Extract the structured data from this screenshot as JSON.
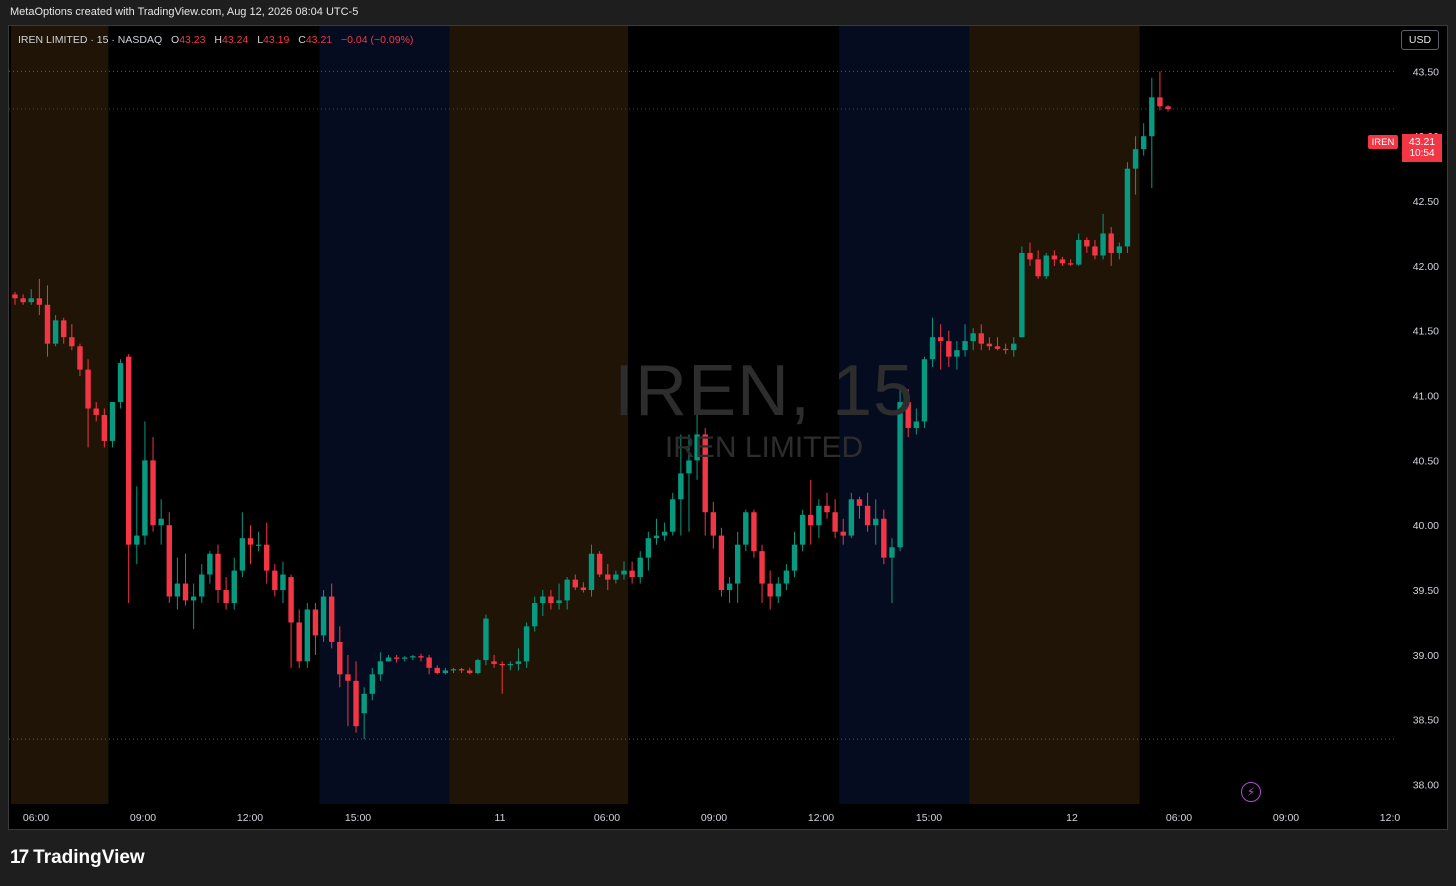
{
  "caption": "MetaOptions created with TradingView.com, Aug 12, 2026 08:04 UTC-5",
  "legend": {
    "symbol": "IREN LIMITED · 15 · NASDAQ",
    "open_key": "O",
    "open": "43.23",
    "high_key": "H",
    "high": "43.24",
    "low_key": "L",
    "low": "43.19",
    "close_key": "C",
    "close": "43.21",
    "change": "−0.04 (−0.09%)"
  },
  "currency_button": "USD",
  "watermark": {
    "main": "IREN, 15",
    "sub": "IREN LIMITED"
  },
  "last_price": {
    "symbol": "IREN",
    "price": "43.21",
    "countdown": "10:54"
  },
  "footer_logo": {
    "mark": "17",
    "text": "TradingView"
  },
  "icons": {
    "alert": "lightning-icon"
  },
  "colors": {
    "up": "#089981",
    "down": "#f23645",
    "premarket": "#1f1406",
    "postmarket": "#050c1f",
    "background": "#000000"
  },
  "chart_data": {
    "type": "candlestick",
    "ylim": [
      37.85,
      43.85
    ],
    "yticks": [
      "43.50",
      "43.00",
      "42.50",
      "42.00",
      "41.50",
      "41.00",
      "40.50",
      "40.00",
      "39.50",
      "39.00",
      "38.50",
      "38.00"
    ],
    "xticks": [
      "06:00",
      "09:00",
      "12:00",
      "15:00",
      "11",
      "06:00",
      "09:00",
      "12:00",
      "15:00",
      "12",
      "06:00",
      "09:00",
      "12:0"
    ],
    "dotted_levels": [
      43.5,
      43.21,
      38.35
    ],
    "session_bands": [
      {
        "type": "premarket",
        "from": 0,
        "to": 12
      },
      {
        "type": "postmarket",
        "from": 38,
        "to": 54
      },
      {
        "type": "premarket",
        "from": 54,
        "to": 76
      },
      {
        "type": "postmarket",
        "from": 102,
        "to": 118
      },
      {
        "type": "premarket",
        "from": 118,
        "to": 139
      }
    ],
    "candles": [
      [
        41.78,
        41.8,
        41.7,
        41.75
      ],
      [
        41.75,
        41.78,
        41.7,
        41.72
      ],
      [
        41.72,
        41.82,
        41.7,
        41.75
      ],
      [
        41.75,
        41.9,
        41.62,
        41.7
      ],
      [
        41.7,
        41.85,
        41.3,
        41.4
      ],
      [
        41.4,
        41.62,
        41.38,
        41.58
      ],
      [
        41.58,
        41.6,
        41.4,
        41.45
      ],
      [
        41.45,
        41.55,
        41.35,
        41.38
      ],
      [
        41.38,
        41.4,
        41.15,
        41.2
      ],
      [
        41.2,
        41.28,
        40.6,
        40.9
      ],
      [
        40.9,
        40.95,
        40.8,
        40.85
      ],
      [
        40.85,
        40.9,
        40.6,
        40.65
      ],
      [
        40.65,
        40.95,
        40.6,
        40.95
      ],
      [
        40.95,
        41.28,
        40.9,
        41.25
      ],
      [
        41.3,
        41.32,
        39.4,
        39.85
      ],
      [
        39.85,
        40.3,
        39.7,
        39.92
      ],
      [
        39.92,
        40.8,
        39.85,
        40.5
      ],
      [
        40.5,
        40.68,
        39.95,
        40.0
      ],
      [
        40.0,
        40.2,
        39.85,
        40.05
      ],
      [
        40.0,
        40.1,
        39.4,
        39.45
      ],
      [
        39.45,
        39.75,
        39.35,
        39.55
      ],
      [
        39.55,
        39.78,
        39.38,
        39.42
      ],
      [
        39.42,
        39.55,
        39.2,
        39.45
      ],
      [
        39.45,
        39.7,
        39.4,
        39.62
      ],
      [
        39.62,
        39.8,
        39.55,
        39.78
      ],
      [
        39.78,
        39.85,
        39.4,
        39.5
      ],
      [
        39.5,
        39.6,
        39.35,
        39.4
      ],
      [
        39.4,
        39.75,
        39.35,
        39.65
      ],
      [
        39.65,
        40.1,
        39.6,
        39.9
      ],
      [
        39.9,
        40.0,
        39.7,
        39.85
      ],
      [
        39.85,
        39.95,
        39.8,
        39.85
      ],
      [
        39.85,
        40.02,
        39.55,
        39.65
      ],
      [
        39.65,
        39.7,
        39.45,
        39.5
      ],
      [
        39.5,
        39.72,
        39.4,
        39.62
      ],
      [
        39.6,
        39.62,
        38.9,
        39.25
      ],
      [
        39.25,
        39.35,
        38.9,
        38.95
      ],
      [
        38.95,
        39.4,
        38.9,
        39.35
      ],
      [
        39.35,
        39.4,
        39.0,
        39.15
      ],
      [
        39.15,
        39.5,
        39.1,
        39.45
      ],
      [
        39.45,
        39.55,
        39.05,
        39.1
      ],
      [
        39.1,
        39.22,
        38.75,
        38.85
      ],
      [
        38.85,
        39.0,
        38.45,
        38.8
      ],
      [
        38.8,
        38.95,
        38.4,
        38.45
      ],
      [
        38.55,
        38.75,
        38.35,
        38.7
      ],
      [
        38.7,
        38.9,
        38.65,
        38.85
      ],
      [
        38.85,
        39.02,
        38.8,
        38.95
      ],
      [
        38.95,
        39.0,
        38.95,
        38.98
      ],
      [
        38.98,
        39.0,
        38.94,
        38.97
      ],
      [
        38.97,
        38.99,
        38.95,
        38.98
      ],
      [
        38.98,
        39.0,
        38.96,
        38.99
      ],
      [
        38.99,
        39.01,
        38.95,
        38.98
      ],
      [
        38.98,
        39.0,
        38.85,
        38.9
      ],
      [
        38.9,
        38.92,
        38.85,
        38.86
      ],
      [
        38.86,
        38.9,
        38.85,
        38.88
      ],
      [
        38.88,
        38.9,
        38.86,
        38.89
      ],
      [
        38.89,
        38.9,
        38.86,
        38.88
      ],
      [
        38.88,
        38.9,
        38.85,
        38.86
      ],
      [
        38.86,
        38.97,
        38.85,
        38.96
      ],
      [
        38.96,
        39.31,
        38.92,
        39.28
      ],
      [
        38.95,
        39.0,
        38.9,
        38.93
      ],
      [
        38.93,
        38.95,
        38.7,
        38.92
      ],
      [
        38.92,
        38.95,
        38.88,
        38.93
      ],
      [
        38.93,
        39.05,
        38.88,
        38.95
      ],
      [
        38.95,
        39.25,
        38.9,
        39.22
      ],
      [
        39.22,
        39.45,
        39.18,
        39.4
      ],
      [
        39.4,
        39.5,
        39.3,
        39.45
      ],
      [
        39.45,
        39.5,
        39.35,
        39.4
      ],
      [
        39.4,
        39.55,
        39.35,
        39.42
      ],
      [
        39.42,
        39.6,
        39.35,
        39.58
      ],
      [
        39.58,
        39.62,
        39.5,
        39.52
      ],
      [
        39.52,
        39.56,
        39.48,
        39.5
      ],
      [
        39.5,
        39.85,
        39.45,
        39.78
      ],
      [
        39.78,
        39.8,
        39.6,
        39.62
      ],
      [
        39.62,
        39.7,
        39.5,
        39.58
      ],
      [
        39.58,
        39.65,
        39.55,
        39.62
      ],
      [
        39.62,
        39.72,
        39.58,
        39.65
      ],
      [
        39.65,
        39.72,
        39.55,
        39.6
      ],
      [
        39.6,
        39.8,
        39.55,
        39.75
      ],
      [
        39.75,
        39.95,
        39.65,
        39.9
      ],
      [
        39.9,
        40.05,
        39.85,
        39.92
      ],
      [
        39.92,
        40.02,
        39.88,
        39.95
      ],
      [
        39.95,
        40.25,
        39.92,
        40.2
      ],
      [
        40.2,
        40.7,
        39.92,
        40.4
      ],
      [
        40.4,
        40.7,
        39.95,
        40.5
      ],
      [
        40.5,
        40.95,
        40.35,
        40.7
      ],
      [
        40.7,
        40.75,
        39.92,
        40.1
      ],
      [
        40.1,
        40.18,
        39.82,
        39.92
      ],
      [
        39.92,
        39.98,
        39.45,
        39.5
      ],
      [
        39.5,
        39.6,
        39.4,
        39.55
      ],
      [
        39.55,
        39.95,
        39.4,
        39.85
      ],
      [
        39.85,
        40.12,
        39.8,
        40.1
      ],
      [
        40.1,
        40.12,
        39.75,
        39.8
      ],
      [
        39.8,
        39.85,
        39.4,
        39.55
      ],
      [
        39.55,
        39.65,
        39.35,
        39.45
      ],
      [
        39.45,
        39.6,
        39.4,
        39.55
      ],
      [
        39.55,
        39.7,
        39.5,
        39.65
      ],
      [
        39.65,
        39.95,
        39.6,
        39.85
      ],
      [
        39.85,
        40.12,
        39.8,
        40.08
      ],
      [
        40.08,
        40.35,
        39.85,
        40.0
      ],
      [
        40.0,
        40.2,
        39.9,
        40.15
      ],
      [
        40.15,
        40.25,
        40.05,
        40.1
      ],
      [
        40.1,
        40.2,
        39.9,
        39.95
      ],
      [
        39.95,
        40.05,
        39.85,
        39.92
      ],
      [
        39.92,
        40.25,
        39.9,
        40.2
      ],
      [
        40.2,
        40.22,
        40.05,
        40.15
      ],
      [
        40.15,
        40.25,
        39.95,
        40.0
      ],
      [
        40.0,
        40.2,
        39.85,
        40.05
      ],
      [
        40.05,
        40.12,
        39.7,
        39.75
      ],
      [
        39.75,
        39.9,
        39.4,
        39.83
      ],
      [
        39.83,
        41.05,
        39.8,
        40.95
      ],
      [
        40.95,
        41.05,
        40.68,
        40.75
      ],
      [
        40.75,
        40.9,
        40.7,
        40.8
      ],
      [
        40.8,
        41.3,
        40.75,
        41.28
      ],
      [
        41.28,
        41.6,
        41.22,
        41.45
      ],
      [
        41.45,
        41.55,
        41.2,
        41.42
      ],
      [
        41.42,
        41.5,
        41.22,
        41.3
      ],
      [
        41.3,
        41.42,
        41.2,
        41.35
      ],
      [
        41.35,
        41.55,
        41.3,
        41.42
      ],
      [
        41.42,
        41.52,
        41.35,
        41.48
      ],
      [
        41.48,
        41.55,
        41.35,
        41.4
      ],
      [
        41.4,
        41.45,
        41.35,
        41.38
      ],
      [
        41.38,
        41.45,
        41.35,
        41.36
      ],
      [
        41.36,
        41.4,
        41.32,
        41.35
      ],
      [
        41.35,
        41.45,
        41.3,
        41.4
      ],
      [
        41.45,
        42.15,
        41.45,
        42.1
      ],
      [
        42.1,
        42.18,
        42.0,
        42.05
      ],
      [
        42.05,
        42.12,
        41.9,
        41.92
      ],
      [
        41.92,
        42.1,
        41.9,
        42.08
      ],
      [
        42.08,
        42.12,
        42.0,
        42.05
      ],
      [
        42.05,
        42.07,
        42.0,
        42.02
      ],
      [
        42.02,
        42.05,
        42.0,
        42.01
      ],
      [
        42.01,
        42.25,
        42.0,
        42.2
      ],
      [
        42.2,
        42.22,
        42.1,
        42.15
      ],
      [
        42.15,
        42.2,
        42.05,
        42.08
      ],
      [
        42.08,
        42.4,
        42.05,
        42.25
      ],
      [
        42.25,
        42.3,
        42.0,
        42.1
      ],
      [
        42.1,
        42.18,
        42.05,
        42.15
      ],
      [
        42.15,
        42.8,
        42.1,
        42.75
      ],
      [
        42.75,
        43.0,
        42.55,
        42.9
      ],
      [
        42.9,
        43.1,
        42.85,
        43.0
      ],
      [
        43.0,
        43.45,
        42.6,
        43.3
      ],
      [
        43.3,
        43.5,
        43.2,
        43.23
      ],
      [
        43.23,
        43.24,
        43.19,
        43.21
      ]
    ]
  }
}
